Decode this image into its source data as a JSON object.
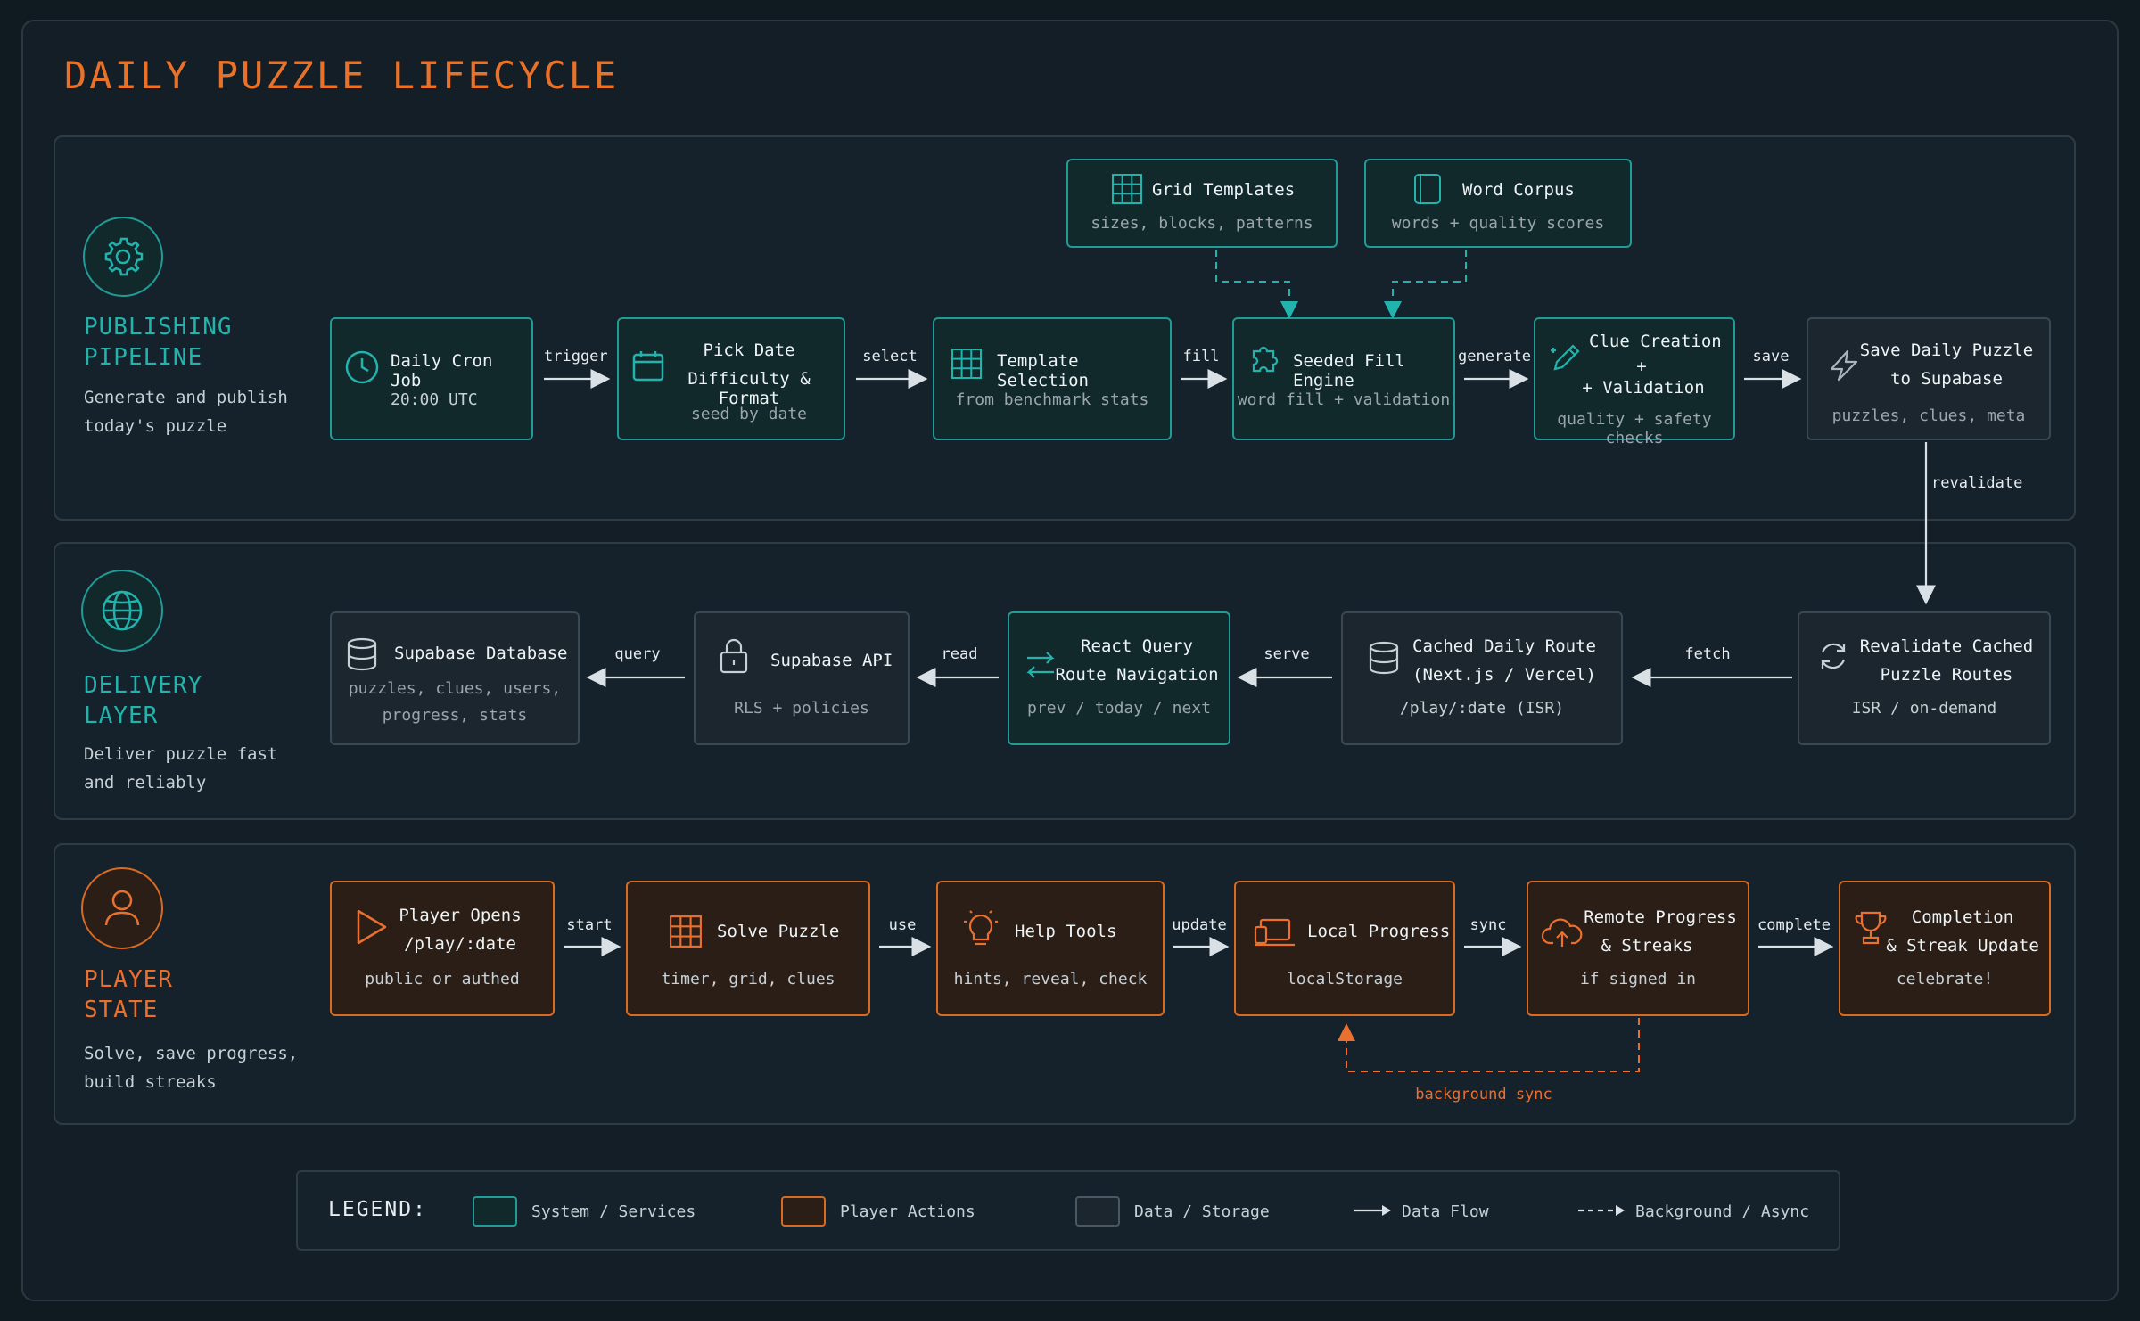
{
  "title": "DAILY PUZZLE LIFECYCLE",
  "colors": {
    "teal": "#1f9c96",
    "orange": "#d96a24",
    "gray": "#3a4853",
    "bg": "#101a21"
  },
  "lanes": {
    "publishing": {
      "heading1": "PUBLISHING",
      "heading2": "PIPELINE",
      "desc1": "Generate and publish",
      "desc2": "today's puzzle",
      "icon": "gear-icon"
    },
    "delivery": {
      "heading1": "DELIVERY",
      "heading2": "LAYER",
      "desc1": "Deliver puzzle fast",
      "desc2": "and reliably",
      "icon": "globe-icon"
    },
    "player": {
      "heading1": "PLAYER",
      "heading2": "STATE",
      "desc1": "Solve, save progress,",
      "desc2": "build streaks",
      "icon": "user-icon"
    }
  },
  "sources": {
    "grid_templates": {
      "title": "Grid Templates",
      "sub": "sizes, blocks, patterns"
    },
    "word_corpus": {
      "title": "Word Corpus",
      "sub": "words + quality scores"
    }
  },
  "publishing_nodes": {
    "cron": {
      "title": "Daily Cron Job",
      "sub": "20:00 UTC"
    },
    "pick_date": {
      "title1": "Pick Date",
      "title2": "Difficulty & Format",
      "sub": "seed by date"
    },
    "template": {
      "title": "Template Selection",
      "sub": "from benchmark stats"
    },
    "fill": {
      "title": "Seeded Fill Engine",
      "sub": "word fill + validation"
    },
    "clue": {
      "title1": "Clue Creation",
      "title2": "+",
      "title3": "+ Validation",
      "sub": "quality + safety checks"
    },
    "save": {
      "title1": "Save Daily Puzzle",
      "title2": "to Supabase",
      "sub": "puzzles, clues, meta"
    }
  },
  "publishing_edges": {
    "trigger": "trigger",
    "select": "select",
    "fill": "fill",
    "generate": "generate",
    "save": "save",
    "revalidate": "revalidate"
  },
  "delivery_nodes": {
    "db": {
      "title": "Supabase Database",
      "sub1": "puzzles, clues, users,",
      "sub2": "progress, stats"
    },
    "api": {
      "title": "Supabase API",
      "sub": "RLS + policies"
    },
    "rq": {
      "title1": "React Query",
      "title2": "Route Navigation",
      "sub": "prev / today / next"
    },
    "cached": {
      "title1": "Cached Daily Route",
      "title2": "(Next.js / Vercel)",
      "sub": "/play/:date (ISR)"
    },
    "reval": {
      "title1": "Revalidate Cached",
      "title2": "Puzzle Routes",
      "sub": "ISR / on-demand"
    }
  },
  "delivery_edges": {
    "query": "query",
    "read": "read",
    "serve": "serve",
    "fetch": "fetch"
  },
  "player_nodes": {
    "opens": {
      "title1": "Player Opens",
      "title2": "/play/:date",
      "sub": "public or authed"
    },
    "solve": {
      "title": "Solve Puzzle",
      "sub": "timer, grid, clues"
    },
    "help": {
      "title": "Help Tools",
      "sub": "hints, reveal, check"
    },
    "local": {
      "title": "Local Progress",
      "sub": "localStorage"
    },
    "remote": {
      "title1": "Remote Progress",
      "title2": "& Streaks",
      "sub": "if signed in"
    },
    "complete": {
      "title1": "Completion",
      "title2": "& Streak Update",
      "sub": "celebrate!"
    }
  },
  "player_edges": {
    "start": "start",
    "use": "use",
    "update": "update",
    "sync": "sync",
    "complete": "complete",
    "background": "background sync"
  },
  "legend": {
    "title": "LEGEND:",
    "system": "System / Services",
    "player": "Player Actions",
    "data": "Data / Storage",
    "flow": "Data Flow",
    "async": "Background / Async"
  }
}
